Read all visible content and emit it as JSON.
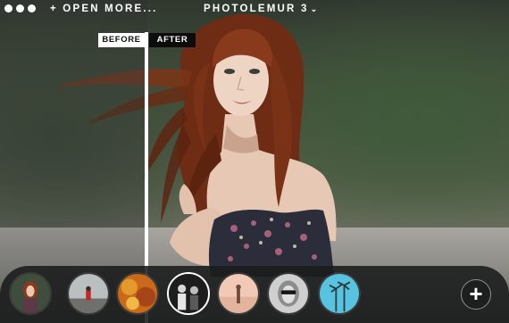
{
  "window": {
    "buttons": [
      "close",
      "minimize",
      "zoom"
    ]
  },
  "toolbar": {
    "open_more_label": "+ OPEN MORE...",
    "app_title": "PHOTOLEMUR 3",
    "title_arrow": "⌄"
  },
  "compare": {
    "before_label": "BEFORE",
    "after_label": "AFTER"
  },
  "presets": {
    "items": [
      {
        "icon": "portrait-redhead-thumbnail"
      },
      {
        "icon": "red-figure-on-pier-thumbnail"
      },
      {
        "icon": "autumn-leaves-thumbnail"
      },
      {
        "icon": "group-portrait-thumbnail",
        "selected": true
      },
      {
        "icon": "beach-walker-thumbnail"
      },
      {
        "icon": "woman-with-sunglasses-thumbnail"
      },
      {
        "icon": "palm-trees-thumbnail"
      }
    ],
    "add_label": "+"
  },
  "colors": {
    "tray": "#191b1b",
    "label_bg": "#ffffff",
    "after_label_bg": "#0c0c0c",
    "hair": "#8a3a1c"
  }
}
